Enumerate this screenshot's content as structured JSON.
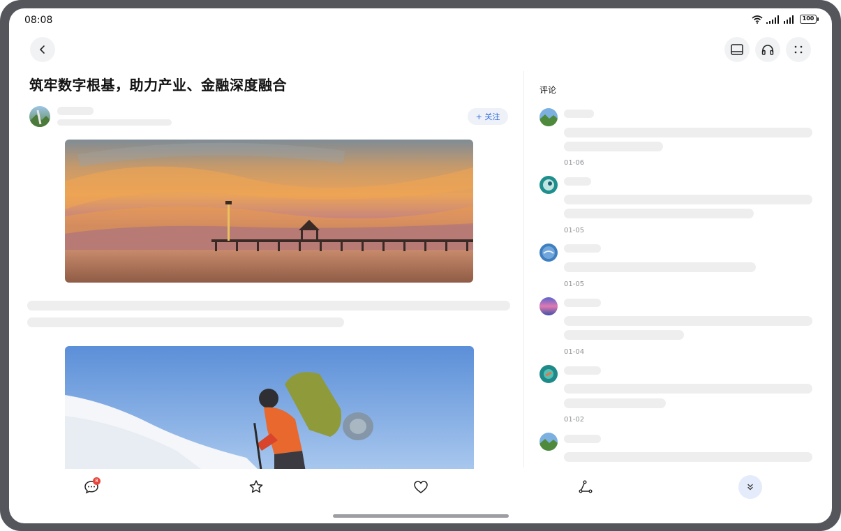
{
  "status_bar": {
    "time": "08:08",
    "battery": "100"
  },
  "article": {
    "title": "筑牢数字根基，助力产业、金融深度融合",
    "follow_label": "+ 关注"
  },
  "comments": {
    "title": "评论",
    "items": [
      {
        "date": "01-06"
      },
      {
        "date": "01-05"
      },
      {
        "date": "01-05"
      },
      {
        "date": "01-04"
      },
      {
        "date": "01-02"
      },
      {
        "date": ""
      }
    ]
  },
  "bottom_bar": {
    "comment_count": "8"
  },
  "icons": {
    "back": "chevron-left-icon",
    "window": "window-icon",
    "listen": "headphones-icon",
    "more": "more-dots-icon",
    "comment": "comment-icon",
    "favorite": "star-icon",
    "like": "heart-icon",
    "share": "share-icon",
    "expand": "double-chevron-down-icon"
  },
  "colors": {
    "accent": "#2f6ce0",
    "badge": "#e8453a",
    "skeleton": "#eeeeef"
  }
}
